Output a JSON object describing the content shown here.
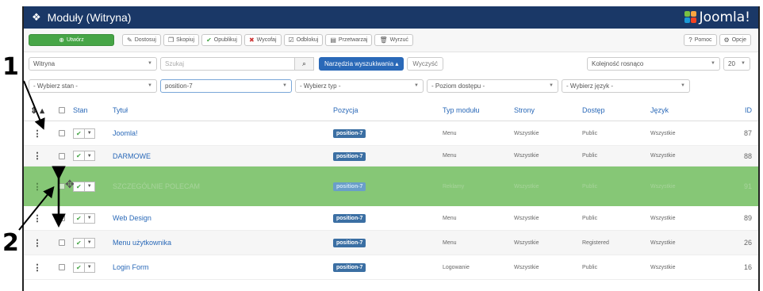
{
  "annotations": {
    "one": "1",
    "two": "2"
  },
  "header": {
    "title": "Moduły (Witryna)",
    "logo_text": "Joomla!"
  },
  "toolbar": {
    "new_label": "Utwórz",
    "edit_label": "Dostosuj",
    "copy_label": "Skopiuj",
    "publish_label": "Opublikuj",
    "unpublish_label": "Wycofaj",
    "checkin_label": "Odblokuj",
    "batch_label": "Przetwarzaj",
    "trash_label": "Wyrzuć",
    "help_label": "Pomoc",
    "options_label": "Opcje"
  },
  "filters": {
    "client_value": "Witryna",
    "search_placeholder": "Szukaj",
    "search_tools_label": "Narzędzia wyszukiwania ▴",
    "clear_label": "Wyczyść",
    "ordering_value": "Kolejność rosnąco",
    "limit_value": "20",
    "state_value": "- Wybierz stan -",
    "position_value": "position-7",
    "type_value": "- Wybierz typ -",
    "access_value": "- Poziom dostępu -",
    "language_value": "- Wybierz język -"
  },
  "table": {
    "headers": {
      "state": "Stan",
      "title": "Tytuł",
      "position": "Pozycja",
      "type": "Typ modułu",
      "pages": "Strony",
      "access": "Dostęp",
      "language": "Język",
      "id": "ID"
    },
    "rows": [
      {
        "title": "Joomla!",
        "position": "position-7",
        "type": "Menu",
        "pages": "Wszystkie",
        "access": "Public",
        "language": "Wszystkie",
        "id": "87"
      },
      {
        "title": "DARMOWE",
        "position": "position-7",
        "type": "Menu",
        "pages": "Wszystkie",
        "access": "Public",
        "language": "Wszystkie",
        "id": "88"
      },
      {
        "title": "SZCZEGÓLNIE POLECAM",
        "position": "position-7",
        "type": "Reklamy",
        "pages": "Wszystkie",
        "access": "Public",
        "language": "Wszystkie",
        "id": "91"
      },
      {
        "title": "Web Design",
        "position": "position-7",
        "type": "Menu",
        "pages": "Wszystkie",
        "access": "Public",
        "language": "Wszystkie",
        "id": "89"
      },
      {
        "title": "Menu użytkownika",
        "position": "position-7",
        "type": "Menu",
        "pages": "Wszystkie",
        "access": "Registered",
        "language": "Wszystkie",
        "id": "26"
      },
      {
        "title": "Login Form",
        "position": "position-7",
        "type": "Logowanie",
        "pages": "Wszystkie",
        "access": "Public",
        "language": "Wszystkie",
        "id": "16"
      }
    ]
  },
  "colors": {
    "header_bg": "#1a3867",
    "new_button": "#46a546",
    "tools_button": "#2a69b8",
    "drag_row": "#86c776",
    "position_badge": "#3b6fa3"
  }
}
